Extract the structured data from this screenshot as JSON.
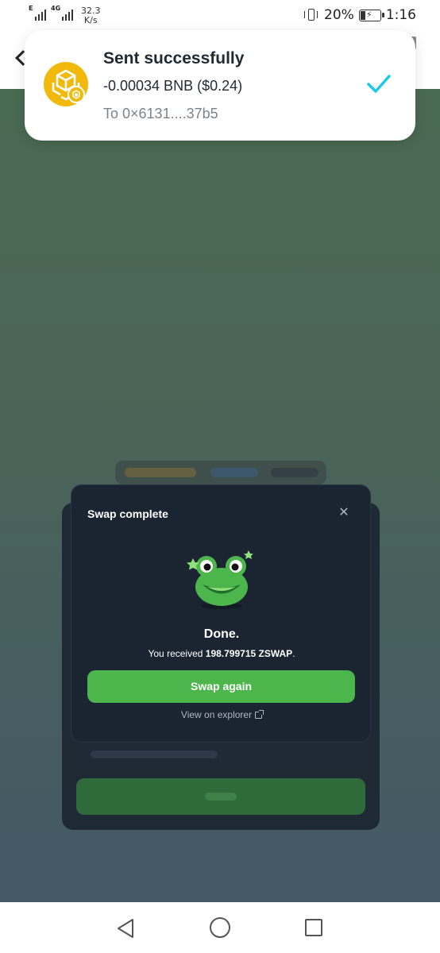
{
  "status_bar": {
    "network_1": "E",
    "network_2": "4G",
    "speed_value": "32.3",
    "speed_unit": "K/s",
    "battery": "20%",
    "time": "1:16"
  },
  "toast": {
    "title": "Sent successfully",
    "amount": "-0.00034 BNB ($0.24)",
    "recipient": "To 0×6131....37b5",
    "accent_color": "#1ec8e8",
    "token_color": "#f0b90b"
  },
  "modal": {
    "title": "Swap complete",
    "close_icon": "close-icon",
    "heading": "Done.",
    "received_prefix": "You received",
    "received_amount": "198.799715 ZSWAP",
    "received_suffix": ".",
    "primary_button": "Swap again",
    "explorer_link": "View on explorer",
    "button_color": "#4cb54c"
  },
  "nav": {
    "back_icon": "triangle-back-icon",
    "home_icon": "circle-home-icon",
    "recent_icon": "square-recents-icon"
  }
}
